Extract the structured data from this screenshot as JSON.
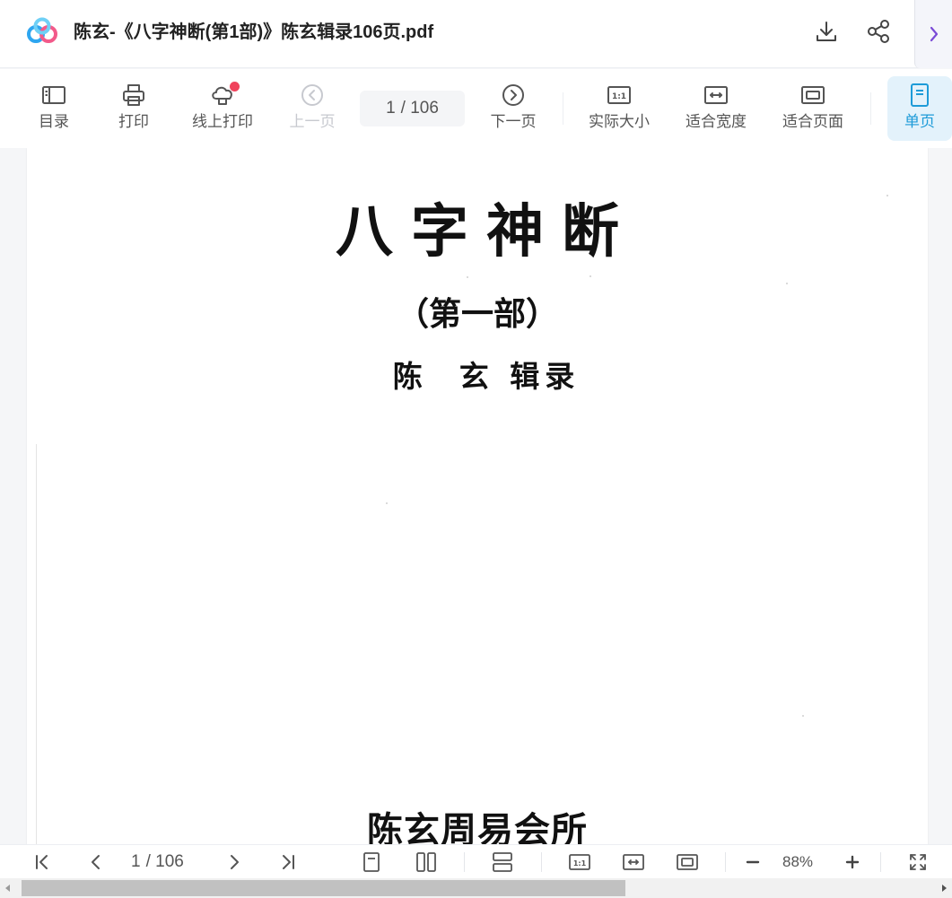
{
  "window": {
    "title": "陈玄-《八字神断(第1部)》陈玄辑录106页.pdf"
  },
  "toolbar": {
    "toc_label": "目录",
    "print_label": "打印",
    "online_print_label": "线上打印",
    "prev_label": "上一页",
    "current_page": "1",
    "total_pages": "/ 106",
    "next_label": "下一页",
    "actual_size_label": "实际大小",
    "fit_width_label": "适合宽度",
    "fit_page_label": "适合页面",
    "single_page_label": "单页"
  },
  "document": {
    "main_title": "八字神断",
    "subtitle": "（第一部）",
    "author": "陈  玄 辑录",
    "publisher": "陈玄周易会所"
  },
  "bottombar": {
    "current_page": "1",
    "total_pages": "/ 106",
    "zoom": "88%"
  },
  "colors": {
    "accent": "#1d9bd8",
    "active_bg": "#e3f2fb",
    "notification_dot": "#f0435c",
    "toggle_chevron": "#7a4bd6"
  },
  "icons": {
    "app_logo": "cloud-rings-logo",
    "download": "download-icon",
    "share": "share-icon",
    "sidebar_toggle": "chevron-right-icon"
  }
}
